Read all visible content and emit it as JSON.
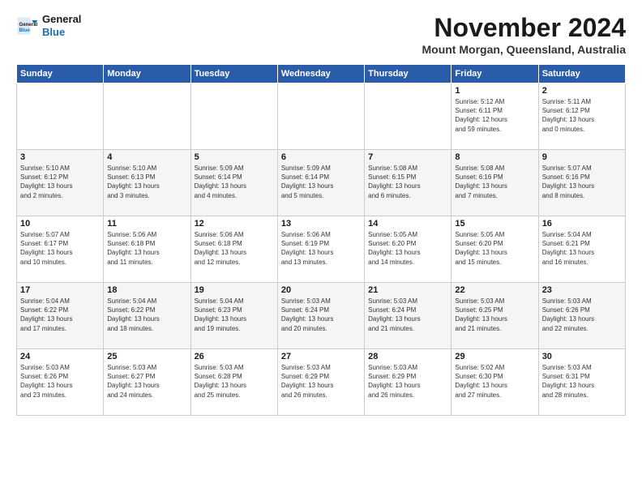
{
  "logo": {
    "line1": "General",
    "line2": "Blue"
  },
  "header": {
    "month": "November 2024",
    "location": "Mount Morgan, Queensland, Australia"
  },
  "weekdays": [
    "Sunday",
    "Monday",
    "Tuesday",
    "Wednesday",
    "Thursday",
    "Friday",
    "Saturday"
  ],
  "weeks": [
    [
      {
        "day": "",
        "info": ""
      },
      {
        "day": "",
        "info": ""
      },
      {
        "day": "",
        "info": ""
      },
      {
        "day": "",
        "info": ""
      },
      {
        "day": "",
        "info": ""
      },
      {
        "day": "1",
        "info": "Sunrise: 5:12 AM\nSunset: 6:11 PM\nDaylight: 12 hours\nand 59 minutes."
      },
      {
        "day": "2",
        "info": "Sunrise: 5:11 AM\nSunset: 6:12 PM\nDaylight: 13 hours\nand 0 minutes."
      }
    ],
    [
      {
        "day": "3",
        "info": "Sunrise: 5:10 AM\nSunset: 6:12 PM\nDaylight: 13 hours\nand 2 minutes."
      },
      {
        "day": "4",
        "info": "Sunrise: 5:10 AM\nSunset: 6:13 PM\nDaylight: 13 hours\nand 3 minutes."
      },
      {
        "day": "5",
        "info": "Sunrise: 5:09 AM\nSunset: 6:14 PM\nDaylight: 13 hours\nand 4 minutes."
      },
      {
        "day": "6",
        "info": "Sunrise: 5:09 AM\nSunset: 6:14 PM\nDaylight: 13 hours\nand 5 minutes."
      },
      {
        "day": "7",
        "info": "Sunrise: 5:08 AM\nSunset: 6:15 PM\nDaylight: 13 hours\nand 6 minutes."
      },
      {
        "day": "8",
        "info": "Sunrise: 5:08 AM\nSunset: 6:16 PM\nDaylight: 13 hours\nand 7 minutes."
      },
      {
        "day": "9",
        "info": "Sunrise: 5:07 AM\nSunset: 6:16 PM\nDaylight: 13 hours\nand 8 minutes."
      }
    ],
    [
      {
        "day": "10",
        "info": "Sunrise: 5:07 AM\nSunset: 6:17 PM\nDaylight: 13 hours\nand 10 minutes."
      },
      {
        "day": "11",
        "info": "Sunrise: 5:06 AM\nSunset: 6:18 PM\nDaylight: 13 hours\nand 11 minutes."
      },
      {
        "day": "12",
        "info": "Sunrise: 5:06 AM\nSunset: 6:18 PM\nDaylight: 13 hours\nand 12 minutes."
      },
      {
        "day": "13",
        "info": "Sunrise: 5:06 AM\nSunset: 6:19 PM\nDaylight: 13 hours\nand 13 minutes."
      },
      {
        "day": "14",
        "info": "Sunrise: 5:05 AM\nSunset: 6:20 PM\nDaylight: 13 hours\nand 14 minutes."
      },
      {
        "day": "15",
        "info": "Sunrise: 5:05 AM\nSunset: 6:20 PM\nDaylight: 13 hours\nand 15 minutes."
      },
      {
        "day": "16",
        "info": "Sunrise: 5:04 AM\nSunset: 6:21 PM\nDaylight: 13 hours\nand 16 minutes."
      }
    ],
    [
      {
        "day": "17",
        "info": "Sunrise: 5:04 AM\nSunset: 6:22 PM\nDaylight: 13 hours\nand 17 minutes."
      },
      {
        "day": "18",
        "info": "Sunrise: 5:04 AM\nSunset: 6:22 PM\nDaylight: 13 hours\nand 18 minutes."
      },
      {
        "day": "19",
        "info": "Sunrise: 5:04 AM\nSunset: 6:23 PM\nDaylight: 13 hours\nand 19 minutes."
      },
      {
        "day": "20",
        "info": "Sunrise: 5:03 AM\nSunset: 6:24 PM\nDaylight: 13 hours\nand 20 minutes."
      },
      {
        "day": "21",
        "info": "Sunrise: 5:03 AM\nSunset: 6:24 PM\nDaylight: 13 hours\nand 21 minutes."
      },
      {
        "day": "22",
        "info": "Sunrise: 5:03 AM\nSunset: 6:25 PM\nDaylight: 13 hours\nand 21 minutes."
      },
      {
        "day": "23",
        "info": "Sunrise: 5:03 AM\nSunset: 6:26 PM\nDaylight: 13 hours\nand 22 minutes."
      }
    ],
    [
      {
        "day": "24",
        "info": "Sunrise: 5:03 AM\nSunset: 6:26 PM\nDaylight: 13 hours\nand 23 minutes."
      },
      {
        "day": "25",
        "info": "Sunrise: 5:03 AM\nSunset: 6:27 PM\nDaylight: 13 hours\nand 24 minutes."
      },
      {
        "day": "26",
        "info": "Sunrise: 5:03 AM\nSunset: 6:28 PM\nDaylight: 13 hours\nand 25 minutes."
      },
      {
        "day": "27",
        "info": "Sunrise: 5:03 AM\nSunset: 6:29 PM\nDaylight: 13 hours\nand 26 minutes."
      },
      {
        "day": "28",
        "info": "Sunrise: 5:03 AM\nSunset: 6:29 PM\nDaylight: 13 hours\nand 26 minutes."
      },
      {
        "day": "29",
        "info": "Sunrise: 5:02 AM\nSunset: 6:30 PM\nDaylight: 13 hours\nand 27 minutes."
      },
      {
        "day": "30",
        "info": "Sunrise: 5:03 AM\nSunset: 6:31 PM\nDaylight: 13 hours\nand 28 minutes."
      }
    ]
  ]
}
